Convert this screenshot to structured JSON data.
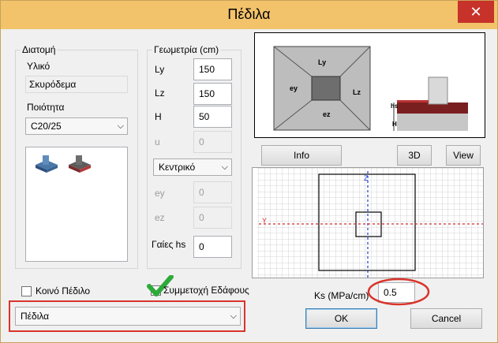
{
  "window": {
    "title": "Πέδιλα",
    "close_icon": "close-icon"
  },
  "section": {
    "section_label": "Διατομή",
    "material_label": "Υλικό",
    "material_value": "Σκυρόδεμα",
    "quality_label": "Ποιότητα",
    "quality_value": "C20/25"
  },
  "geometry": {
    "label": "Γεωμετρία (cm)",
    "ly_label": "Ly",
    "ly_value": "150",
    "lz_label": "Lz",
    "lz_value": "150",
    "h_label": "H",
    "h_value": "50",
    "u_label": "u",
    "u_value": "0",
    "position_value": "Κεντρικό",
    "ey_label": "ey",
    "ey_value": "0",
    "ez_label": "ez",
    "ez_value": "0",
    "hs_label": "Γαίες hs",
    "hs_value": "0"
  },
  "preview": {
    "ly_tag": "Ly",
    "ey_tag": "ey",
    "lz_tag": "Lz",
    "ez_tag": "ez",
    "h_tag": "H",
    "hs_tag": "hs"
  },
  "buttons": {
    "info": "Info",
    "three_d": "3D",
    "view": "View",
    "ok": "OK",
    "cancel": "Cancel"
  },
  "grid": {
    "z_axis": "Z",
    "y_axis": "Y"
  },
  "options": {
    "common_footing": "Κοινό Πέδιλο",
    "soil_participation": "Συμμετοχή Εδάφους",
    "ks_label": "Ks (MPa/cm)",
    "ks_value": "0.5",
    "type_value": "Πέδιλα"
  },
  "colors": {
    "titlebar": "#f2c36b",
    "close": "#c7322a",
    "highlight": "#d9342b",
    "checkmark": "#2eaa3b"
  }
}
